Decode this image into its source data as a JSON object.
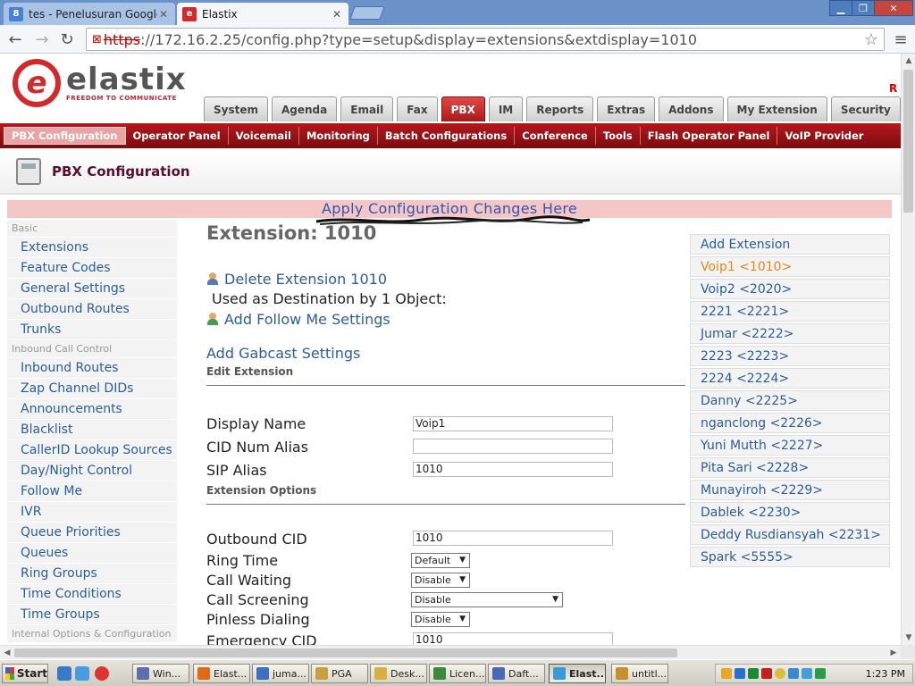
{
  "browser": {
    "tabs": [
      {
        "title": "tes - Penelusuran Google",
        "favicon": "8",
        "active": false
      },
      {
        "title": "Elastix",
        "favicon": "e",
        "active": true
      }
    ],
    "url_proto": "https",
    "url_rest": "://172.16.2.25/config.php?type=setup&display=extensions&extdisplay=1010"
  },
  "header": {
    "brand": "elastix",
    "tagline": "FREEDOM TO COMMUNICATE",
    "corner_link": "R"
  },
  "main_tabs": [
    "System",
    "Agenda",
    "Email",
    "Fax",
    "PBX",
    "IM",
    "Reports",
    "Extras",
    "Addons",
    "My Extension",
    "Security"
  ],
  "main_tabs_active": "PBX",
  "sub_tabs": [
    "PBX Configuration",
    "Operator Panel",
    "Voicemail",
    "Monitoring",
    "Batch Configurations",
    "Conference",
    "Tools",
    "Flash Operator Panel",
    "VoIP Provider"
  ],
  "sub_tabs_active": "PBX Configuration",
  "page_title": "PBX Configuration",
  "apply_link": "Apply Configuration Changes Here",
  "left_nav": [
    {
      "type": "cat",
      "label": "Basic"
    },
    {
      "type": "item",
      "label": "Extensions"
    },
    {
      "type": "item",
      "label": "Feature Codes"
    },
    {
      "type": "item",
      "label": "General Settings"
    },
    {
      "type": "item",
      "label": "Outbound Routes"
    },
    {
      "type": "item",
      "label": "Trunks"
    },
    {
      "type": "cat",
      "label": "Inbound Call Control"
    },
    {
      "type": "item",
      "label": "Inbound Routes"
    },
    {
      "type": "item",
      "label": "Zap Channel DIDs"
    },
    {
      "type": "item",
      "label": "Announcements"
    },
    {
      "type": "item",
      "label": "Blacklist"
    },
    {
      "type": "item",
      "label": "CallerID Lookup Sources"
    },
    {
      "type": "item",
      "label": "Day/Night Control"
    },
    {
      "type": "item",
      "label": "Follow Me"
    },
    {
      "type": "item",
      "label": "IVR"
    },
    {
      "type": "item",
      "label": "Queue Priorities"
    },
    {
      "type": "item",
      "label": "Queues"
    },
    {
      "type": "item",
      "label": "Ring Groups"
    },
    {
      "type": "item",
      "label": "Time Conditions"
    },
    {
      "type": "item",
      "label": "Time Groups"
    },
    {
      "type": "cat",
      "label": "Internal Options & Configuration"
    }
  ],
  "form": {
    "heading": "Extension: 1010",
    "delete_link": "Delete Extension 1010",
    "used_as": "Used as Destination by 1 Object:",
    "follow_me_link": "Add Follow Me Settings",
    "gabcast_link": "Add Gabcast Settings",
    "edit_section": "Edit Extension",
    "options_section": "Extension Options",
    "display_name_label": "Display Name",
    "display_name_value": "Voip1",
    "cid_alias_label": "CID Num Alias",
    "cid_alias_value": "",
    "sip_alias_label": "SIP Alias",
    "sip_alias_value": "1010",
    "outbound_cid_label": "Outbound CID",
    "outbound_cid_value": "1010",
    "ring_time_label": "Ring Time",
    "ring_time_value": "Default",
    "call_waiting_label": "Call Waiting",
    "call_waiting_value": "Disable",
    "call_screening_label": "Call Screening",
    "call_screening_value": "Disable",
    "pinless_label": "Pinless Dialing",
    "pinless_value": "Disable",
    "emergency_cid_label": "Emergency CID",
    "emergency_cid_value": "1010"
  },
  "ext_list": [
    "Add Extension",
    "Voip1 <1010>",
    "Voip2 <2020>",
    "2221 <2221>",
    "Jumar <2222>",
    "2223 <2223>",
    "2224 <2224>",
    "Danny <2225>",
    "nganclong <2226>",
    "Yuni Mutth <2227>",
    "Pita Sari <2228>",
    "Munayiroh <2229>",
    "Dablek <2230>",
    "Deddy Rusdiansyah <2231>",
    "Spark <5555>"
  ],
  "ext_list_current": "Voip1 <1010>",
  "taskbar": {
    "start": "Start",
    "items": [
      "Win...",
      "Elast...",
      "juma...",
      "PGA",
      "Desk...",
      "Licen...",
      "Daft...",
      "Elast...",
      "untitl..."
    ],
    "active_item": 7,
    "clock": "1:23 PM"
  },
  "colors": {
    "brand_red": "#b4191d",
    "link_blue": "#2b5d9c",
    "current_ext": "#e8841a",
    "apply_bg": "#f5c6c6"
  }
}
